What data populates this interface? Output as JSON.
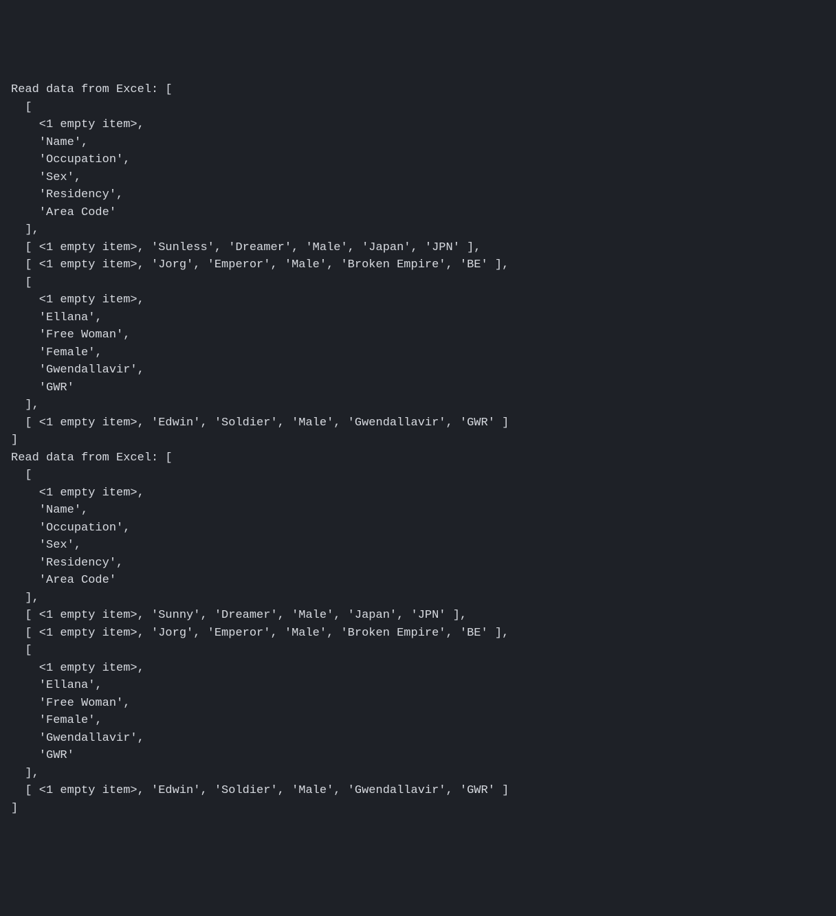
{
  "console": {
    "blocks": [
      {
        "label": "Read data from Excel:",
        "rows": [
          [
            "<1 empty item>",
            "'Name'",
            "'Occupation'",
            "'Sex'",
            "'Residency'",
            "'Area Code'"
          ],
          [
            "<1 empty item>",
            "'Sunless'",
            "'Dreamer'",
            "'Male'",
            "'Japan'",
            "'JPN'"
          ],
          [
            "<1 empty item>",
            "'Jorg'",
            "'Emperor'",
            "'Male'",
            "'Broken Empire'",
            "'BE'"
          ],
          [
            "<1 empty item>",
            "'Ellana'",
            "'Free Woman'",
            "'Female'",
            "'Gwendallavir'",
            "'GWR'"
          ],
          [
            "<1 empty item>",
            "'Edwin'",
            "'Soldier'",
            "'Male'",
            "'Gwendallavir'",
            "'GWR'"
          ]
        ],
        "expanded": [
          true,
          false,
          false,
          true,
          false
        ]
      },
      {
        "label": "Read data from Excel:",
        "rows": [
          [
            "<1 empty item>",
            "'Name'",
            "'Occupation'",
            "'Sex'",
            "'Residency'",
            "'Area Code'"
          ],
          [
            "<1 empty item>",
            "'Sunny'",
            "'Dreamer'",
            "'Male'",
            "'Japan'",
            "'JPN'"
          ],
          [
            "<1 empty item>",
            "'Jorg'",
            "'Emperor'",
            "'Male'",
            "'Broken Empire'",
            "'BE'"
          ],
          [
            "<1 empty item>",
            "'Ellana'",
            "'Free Woman'",
            "'Female'",
            "'Gwendallavir'",
            "'GWR'"
          ],
          [
            "<1 empty item>",
            "'Edwin'",
            "'Soldier'",
            "'Male'",
            "'Gwendallavir'",
            "'GWR'"
          ]
        ],
        "expanded": [
          true,
          false,
          false,
          true,
          false
        ]
      }
    ]
  }
}
